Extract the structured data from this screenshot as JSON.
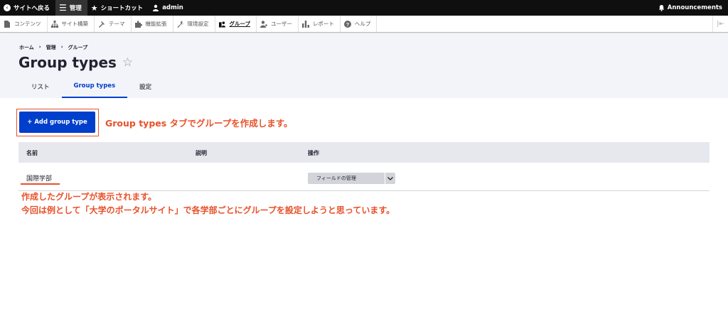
{
  "toolbar": {
    "back_to_site": "サイトへ戻る",
    "manage": "管理",
    "shortcuts": "ショートカット",
    "user": "admin",
    "announcements": "Announcements"
  },
  "tray": {
    "items": [
      {
        "label": "コンテンツ",
        "icon": "document-icon"
      },
      {
        "label": "サイト構築",
        "icon": "sitemap-icon"
      },
      {
        "label": "テーマ",
        "icon": "paint-roller-icon"
      },
      {
        "label": "機能拡張",
        "icon": "puzzle-icon"
      },
      {
        "label": "環境設定",
        "icon": "wrench-icon"
      },
      {
        "label": "グループ",
        "icon": "group-icon"
      },
      {
        "label": "ユーザー",
        "icon": "user-icon"
      },
      {
        "label": "レポート",
        "icon": "bar-chart-icon"
      },
      {
        "label": "ヘルプ",
        "icon": "help-icon"
      }
    ]
  },
  "breadcrumb": [
    "ホーム",
    "管理",
    "グループ"
  ],
  "breadcrumb_separator": "›",
  "page": {
    "title": "Group types",
    "star": "☆"
  },
  "tabs": [
    "リスト",
    "Group types",
    "設定"
  ],
  "add_button": "+ Add group type",
  "annotation1": "Group types タブでグループを作成します。",
  "table": {
    "headers": [
      "名前",
      "説明",
      "操作"
    ],
    "rows": [
      {
        "name": "国際学部",
        "description": "",
        "operation": "フィールドの管理"
      }
    ]
  },
  "annotation2_line1": "作成したグループが表示されます。",
  "annotation2_line2": "今回は例として「大学のポータルサイト」で各学部ごとにグループを設定しようと思っています。",
  "colors": {
    "primary": "#003ecc",
    "annotation": "#e8512a",
    "toolbar": "#0f0f0f"
  }
}
